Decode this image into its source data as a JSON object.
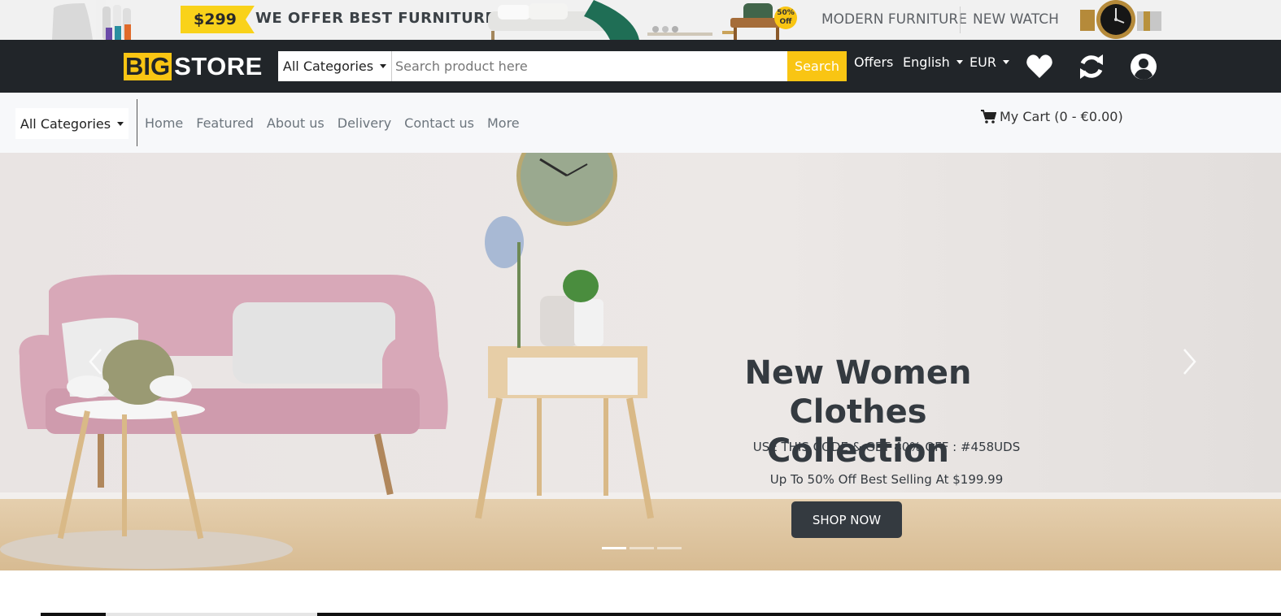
{
  "promo": {
    "price": "$299",
    "headline": "WE OFFER BEST FURNITURE",
    "badge_percent": "50%",
    "badge_off": "Off",
    "link_modern": "MODERN FURNITURE",
    "link_watch": "NEW WATCH"
  },
  "header": {
    "logo_big": "BIG",
    "logo_store": "STORE",
    "category_label": "All Categories",
    "search_placeholder": "Search product here",
    "search_button": "Search",
    "offers": "Offers",
    "language": "English",
    "currency": "EUR",
    "icons": [
      "heart-icon",
      "refresh-icon",
      "user-icon"
    ]
  },
  "nav": {
    "category_label": "All Categories",
    "links": [
      "Home",
      "Featured",
      "About us",
      "Delivery",
      "Contact us",
      "More"
    ],
    "cart": "My Cart (0 - €0.00)"
  },
  "hero": {
    "title_line1": "New Women Clothes",
    "title_line2": "Collection",
    "code_text": "USE THIS CODE & GET 40% OFF : #458UDS",
    "sub_text": "Up To 50% Off Best Selling At $199.99",
    "button": "SHOP NOW",
    "slides": 3,
    "active_slide": 1
  },
  "colors": {
    "accent": "#f9c513",
    "header_bg": "#212529",
    "nav_bg": "#f7f8fa",
    "text_dark": "#343a40"
  }
}
